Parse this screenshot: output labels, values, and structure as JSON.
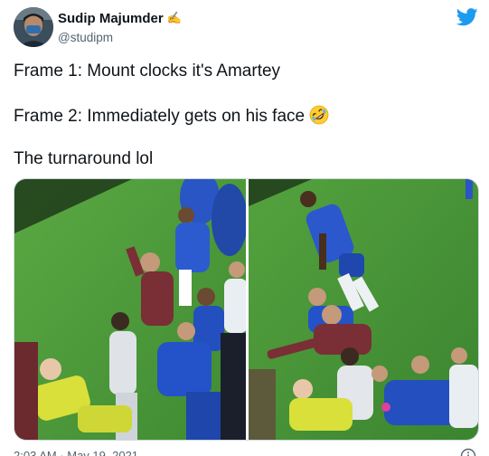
{
  "author": {
    "display_name": "Sudip Majumder",
    "name_emoji": "✍️",
    "handle": "@studipm",
    "avatar_icon": "profile-photo"
  },
  "tweet": {
    "line1": "Frame 1: Mount clocks it's Amartey",
    "line2": "Frame 2: Immediately gets on his face",
    "line2_emoji": "rolling-on-the-floor-laughing",
    "line3": "The turnaround lol"
  },
  "media": {
    "photos": [
      "frame-1-photo",
      "frame-2-photo"
    ]
  },
  "footer": {
    "timestamp": "2:03 AM · May 19, 2021"
  },
  "colors": {
    "brand_blue": "#1d9bf0",
    "text_primary": "#0f1419",
    "text_secondary": "#536471",
    "pitch_green": "#4f9b3a",
    "chelsea_blue": "#1e4ab5",
    "leicester_maroon": "#7a2e35",
    "keeper_yellow": "#d9e03a"
  }
}
